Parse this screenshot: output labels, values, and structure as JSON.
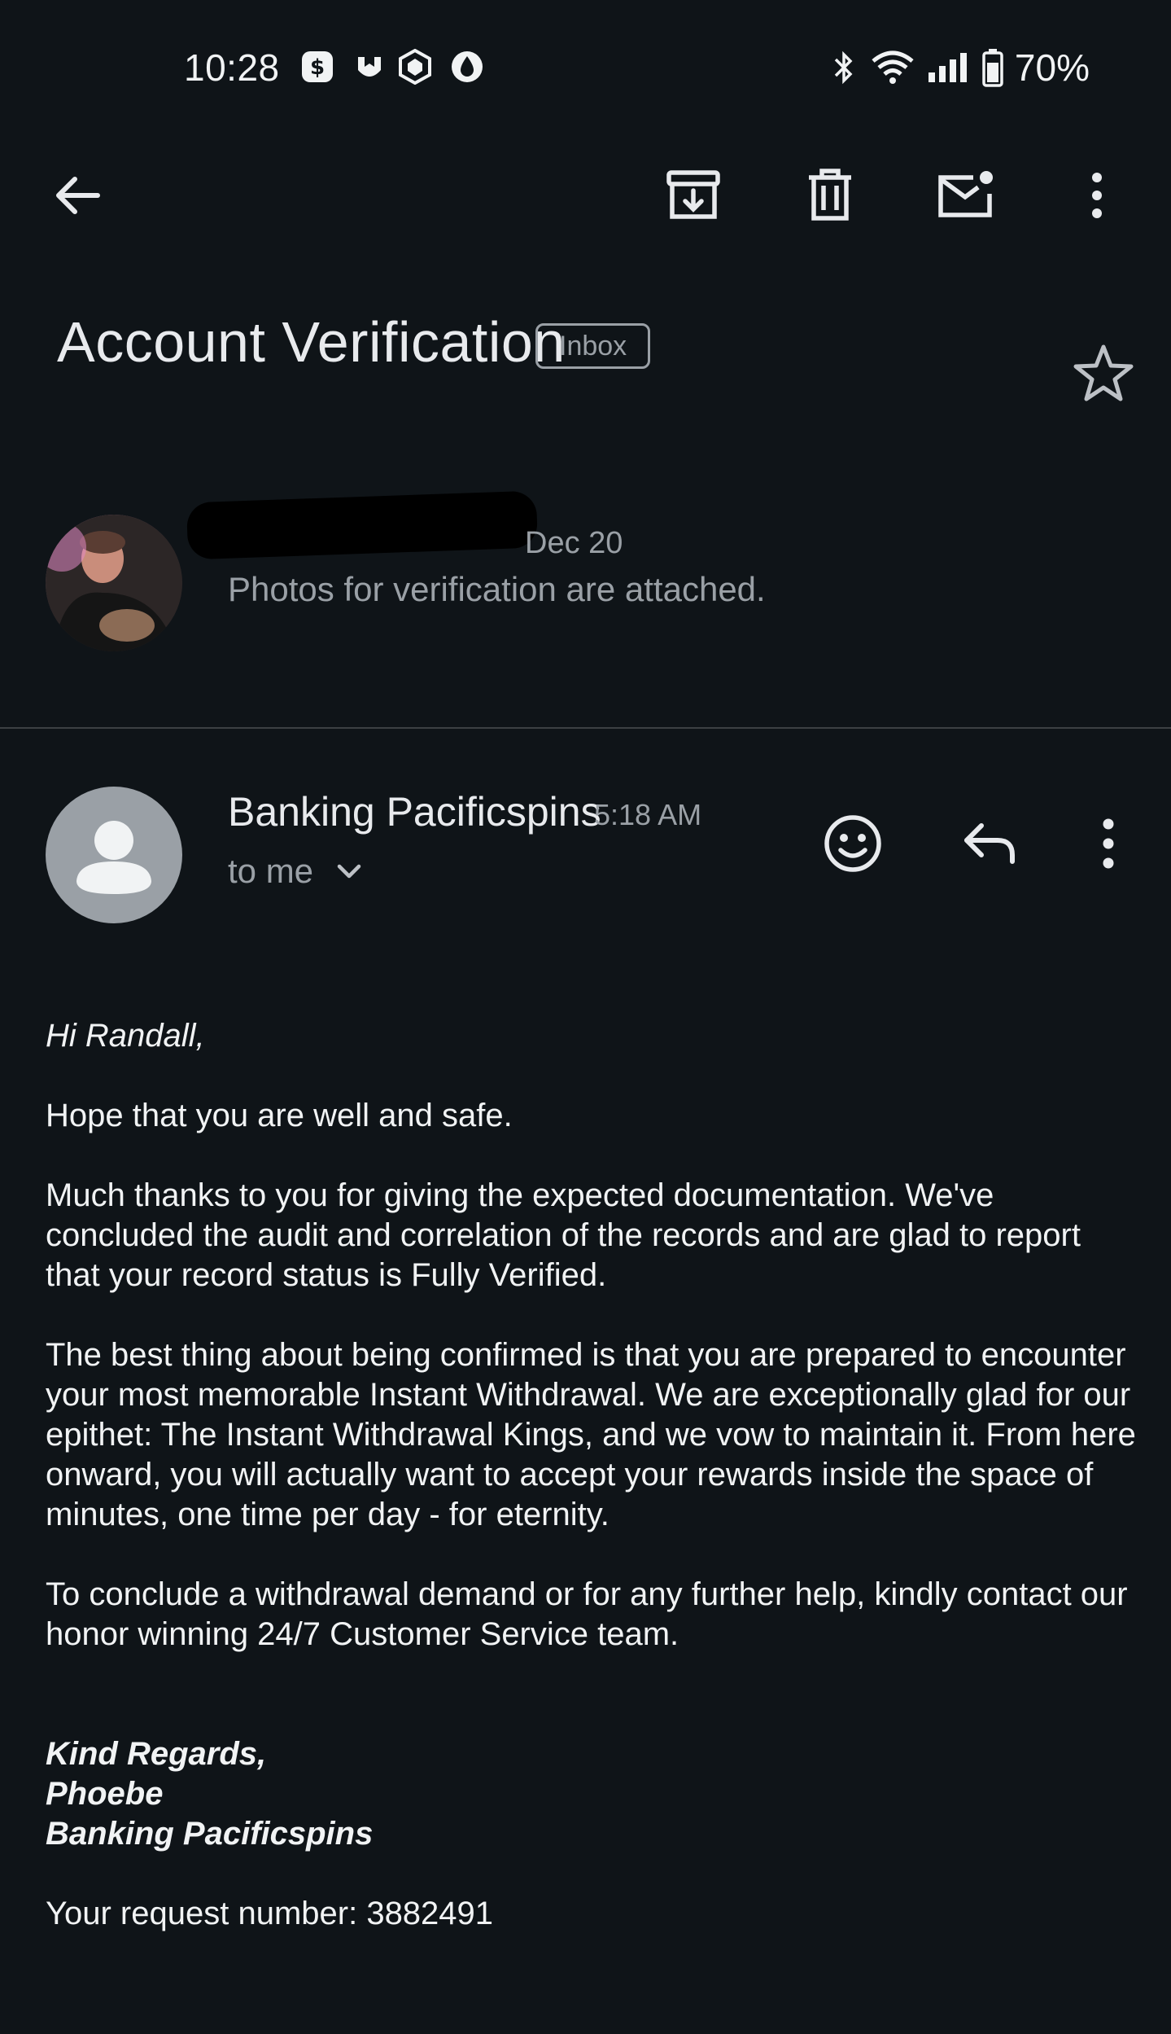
{
  "status_bar": {
    "time": "10:28",
    "battery": "70%",
    "icons": [
      "cash-app-icon",
      "shield-app-icon",
      "crypto-app-icon",
      "drop-app-icon",
      "bluetooth-icon",
      "wifi-icon",
      "signal-icon",
      "battery-icon"
    ]
  },
  "toolbar": {
    "icons": [
      "back-arrow-icon",
      "archive-icon",
      "delete-icon",
      "mark-unread-icon",
      "more-vert-icon"
    ]
  },
  "email": {
    "subject": "Account Verification",
    "label": "Inbox"
  },
  "thread": {
    "prev_message": {
      "date": "Dec 20",
      "snippet": "Photos for verification are attached."
    },
    "message": {
      "sender": "Banking Pacificspins",
      "time": "5:18 AM",
      "recipient": "to me",
      "greeting": "Hi Randall,",
      "paragraphs": [
        "Hope that you are well and safe.",
        "Much thanks to you for giving the expected documentation. We've concluded the audit and correlation of the records and are glad to report that your record status is Fully Verified.",
        "The best thing about being confirmed is that you are prepared to encounter your most memorable Instant Withdrawal. We are exceptionally glad for our epithet: The Instant Withdrawal Kings, and we vow to maintain it. From here onward, you will actually want to accept your rewards inside the space of minutes, one time per day - for eternity.",
        "To conclude a withdrawal demand or for any further help, kindly contact our honor winning 24/7 Customer Service team."
      ],
      "signature": [
        "Kind Regards,",
        "Phoebe",
        "Banking Pacificspins"
      ],
      "request_line": "Your request number: 3882491"
    }
  },
  "colors": {
    "background": "#0f1418",
    "text": "#e8eaed",
    "secondary": "#9aa0a6",
    "divider": "#3c4043"
  }
}
